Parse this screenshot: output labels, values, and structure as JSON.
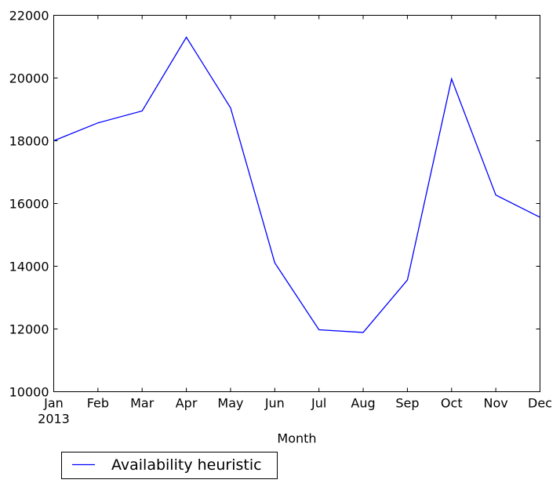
{
  "chart_data": {
    "type": "line",
    "title": "",
    "xlabel": "Month",
    "ylabel": "",
    "categories": [
      "Jan",
      "Feb",
      "Mar",
      "Apr",
      "May",
      "Jun",
      "Jul",
      "Aug",
      "Sep",
      "Oct",
      "Nov",
      "Dec"
    ],
    "x_sublabel": {
      "index": 0,
      "text": "2013"
    },
    "ylim": [
      10000,
      22000
    ],
    "yticks": [
      10000,
      12000,
      14000,
      16000,
      18000,
      20000,
      22000
    ],
    "grid": false,
    "legend_position": "below-left",
    "series": [
      {
        "name": "Availability heuristic",
        "color": "#0000ff",
        "values": [
          18000,
          18570,
          18950,
          21300,
          19050,
          14110,
          11975,
          11890,
          13560,
          19970,
          16270,
          15560
        ]
      }
    ]
  }
}
